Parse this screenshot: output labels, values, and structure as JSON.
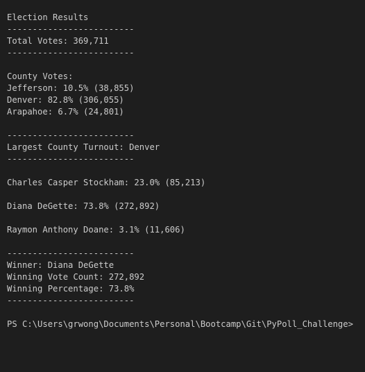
{
  "terminal": {
    "lines": [
      "Election Results",
      "-------------------------",
      "Total Votes: 369,711",
      "-------------------------",
      "",
      "County Votes:",
      "Jefferson: 10.5% (38,855)",
      "Denver: 82.8% (306,055)",
      "Arapahoe: 6.7% (24,801)",
      "",
      "-------------------------",
      "Largest County Turnout: Denver",
      "-------------------------",
      "",
      "Charles Casper Stockham: 23.0% (85,213)",
      "",
      "Diana DeGette: 73.8% (272,892)",
      "",
      "Raymon Anthony Doane: 3.1% (11,606)",
      "",
      "-------------------------",
      "Winner: Diana DeGette",
      "Winning Vote Count: 272,892",
      "Winning Percentage: 73.8%",
      "-------------------------",
      "",
      "PS C:\\Users\\grwong\\Documents\\Personal\\Bootcamp\\Git\\PyPoll_Challenge>"
    ]
  },
  "colors": {
    "background": "#1e1e1e",
    "text": "#cccccc"
  }
}
